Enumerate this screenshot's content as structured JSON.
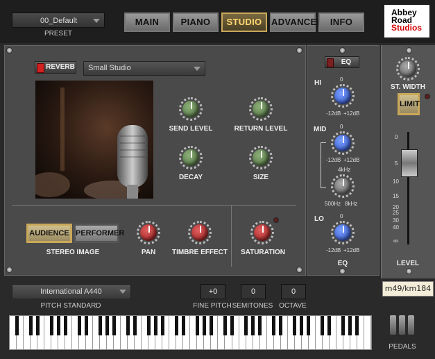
{
  "preset": {
    "value": "00_Default",
    "label": "PRESET"
  },
  "tabs": [
    {
      "label": "MAIN"
    },
    {
      "label": "PIANO"
    },
    {
      "label": "STUDIO"
    },
    {
      "label": "ADVANCED"
    },
    {
      "label": "INFO"
    }
  ],
  "active_tab": "STUDIO",
  "logo": {
    "line1": "Abbey",
    "line2": "Road",
    "line3": "Studios"
  },
  "reverb": {
    "toggle_label": "REVERB",
    "room_value": "Small Studio",
    "knobs": [
      {
        "label": "SEND LEVEL"
      },
      {
        "label": "RETURN LEVEL"
      },
      {
        "label": "DECAY"
      },
      {
        "label": "SIZE"
      }
    ]
  },
  "stereo": {
    "audience_label": "AUDIENCE",
    "performer_label": "PERFORMER",
    "section_label": "STEREO IMAGE",
    "pan_label": "PAN",
    "timbre_label": "TIMBRE EFFECT",
    "saturation_label": "SATURATION"
  },
  "eq": {
    "toggle_label": "EQ",
    "hi_label": "HI",
    "mid_label": "MID",
    "lo_label": "LO",
    "zero": "0",
    "min": "-12dB",
    "max": "+12dB",
    "freq_center": "4kHz",
    "freq_min": "500Hz",
    "freq_max": "8kHz",
    "section_label": "EQ"
  },
  "output": {
    "width_label": "ST. WIDTH",
    "limit_label": "LIMIT",
    "scale": [
      "0",
      "5",
      "10",
      "15",
      "20",
      "25",
      "30",
      "40",
      "∞"
    ],
    "level_label": "LEVEL",
    "tag_text": "m49/km184"
  },
  "pitch": {
    "standard_value": "International A440",
    "standard_label": "PITCH STANDARD",
    "fine_value": "+0",
    "fine_label": "FINE PITCH",
    "semitones_value": "0",
    "semitones_label": "SEMITONES",
    "octave_value": "0",
    "octave_label": "OCTAVE"
  },
  "pedals_label": "PEDALS"
}
